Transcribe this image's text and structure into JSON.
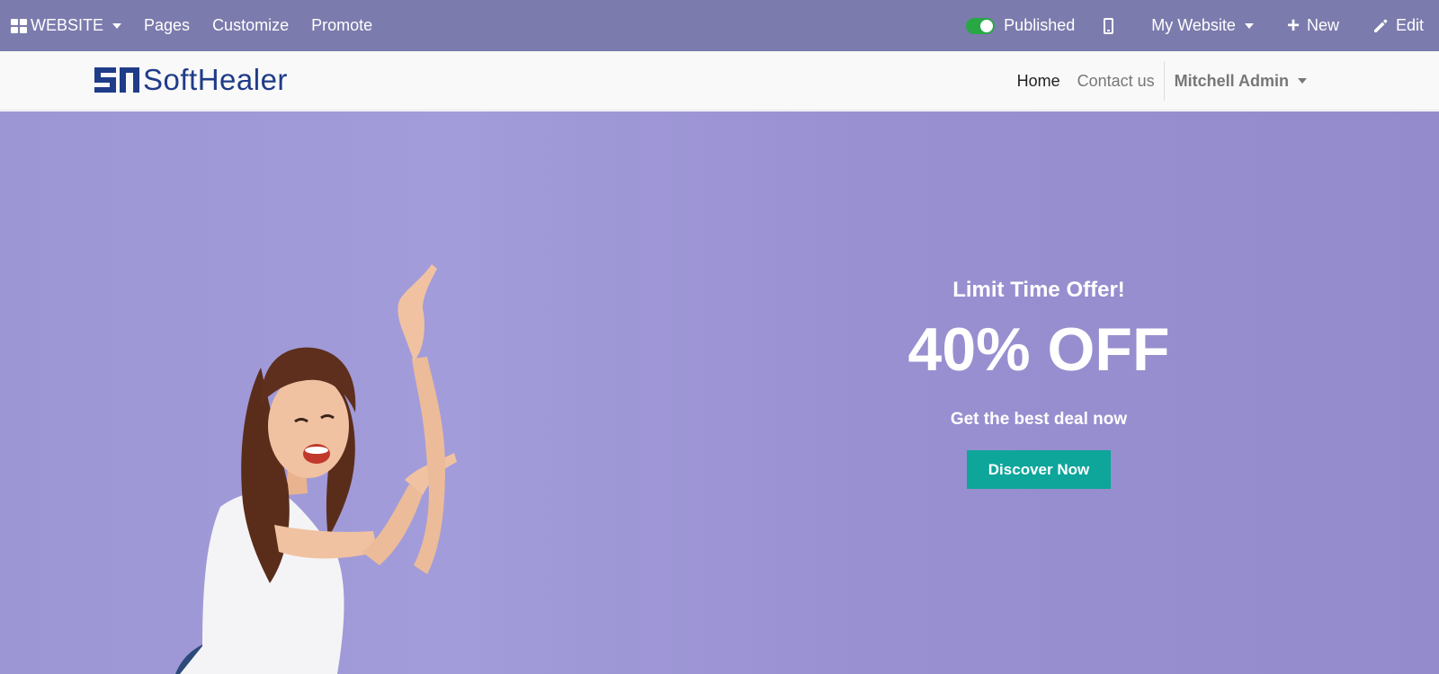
{
  "admin_bar": {
    "app_label": "WEBSITE",
    "menu": [
      "Pages",
      "Customize",
      "Promote"
    ],
    "published_label": "Published",
    "website_label": "My Website",
    "new_label": "New",
    "edit_label": "Edit",
    "published": true
  },
  "site_header": {
    "logo_text": "SoftHealer",
    "nav": [
      "Home",
      "Contact us"
    ],
    "user": "Mitchell Admin"
  },
  "hero": {
    "kicker": "Limit Time Offer!",
    "headline": "40% OFF",
    "subline": "Get the best deal now",
    "cta_label": "Discover Now"
  },
  "colors": {
    "admin_bar": "#7c7bad",
    "hero_background": "#9c96d4",
    "cta": "#0ea59b",
    "logo": "#1f3c88",
    "toggle_on": "#28a745"
  }
}
